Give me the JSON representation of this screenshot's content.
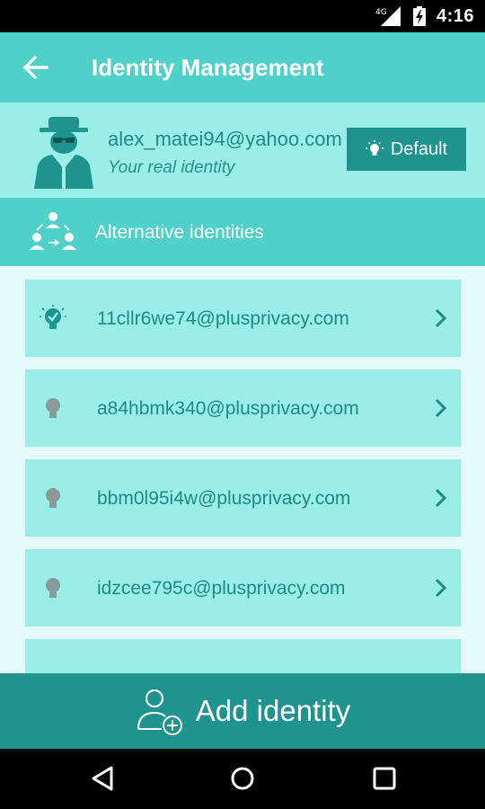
{
  "status_bar": {
    "network": "4G",
    "time": "4:16",
    "icons": [
      "signal-icon",
      "battery-icon"
    ]
  },
  "app_bar": {
    "title": "Identity Management",
    "back_icon": "back-arrow-icon"
  },
  "real_identity": {
    "email": "alex_matei94@yahoo.com",
    "subtitle": "Your real identity",
    "default_button_label": "Default",
    "avatar_icon": "spy-avatar-icon"
  },
  "alternative_section": {
    "label": "Alternative identities",
    "icon": "people-network-icon"
  },
  "identities": [
    {
      "email": "11cllr6we74@plusprivacy.com",
      "active": true,
      "icon": "lightbulb-check-icon"
    },
    {
      "email": "a84hbmk340@plusprivacy.com",
      "active": false,
      "icon": "lightbulb-icon"
    },
    {
      "email": "bbm0l95i4w@plusprivacy.com",
      "active": false,
      "icon": "lightbulb-icon"
    },
    {
      "email": "idzcee795c@plusprivacy.com",
      "active": false,
      "icon": "lightbulb-icon"
    }
  ],
  "add_button": {
    "label": "Add identity",
    "icon": "add-user-icon"
  },
  "colors": {
    "primary": "#4fd0c8",
    "primary_dark": "#1f938e",
    "card": "#9aeeea",
    "background": "#e4fbfa",
    "text": "#1f8a86"
  }
}
